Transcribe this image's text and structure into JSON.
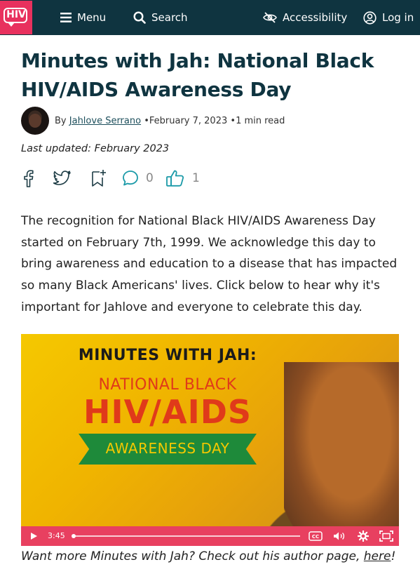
{
  "nav": {
    "logo_text": "HIV",
    "menu_label": "Menu",
    "search_label": "Search",
    "accessibility_label": "Accessibility",
    "login_label": "Log in",
    "background_color": "#0f3440",
    "logo_color": "#e8315e"
  },
  "article": {
    "title": "Minutes with Jah: National Black HIV/AIDS Awareness Day",
    "byline": {
      "by": "By",
      "author": "Jahlove Serrano",
      "date": "February 7, 2023",
      "read_time": "1 min read"
    },
    "last_updated": "Last updated: February 2023",
    "actions": {
      "comment_count": "0",
      "like_count": "1"
    },
    "body": "The recognition for National Black HIV/AIDS Awareness Day started on February 7th, 1999. We acknowledge this day to bring awareness and education to a disease that has impacted so many Black Americans' lives.  Click below to hear why it's important for Jahlove and everyone to celebrate this day."
  },
  "video": {
    "line1": "MINUTES WITH JAH:",
    "line2": "NATIONAL BLACK",
    "line3": "HIV/AIDS",
    "banner": "AWARENESS DAY",
    "duration": "3:45",
    "progress_fraction": 0.0,
    "controls_color": "#e84060"
  },
  "caption": {
    "before": "Want more Minutes with Jah? Check out his author page, ",
    "link": "here",
    "after": "!"
  }
}
